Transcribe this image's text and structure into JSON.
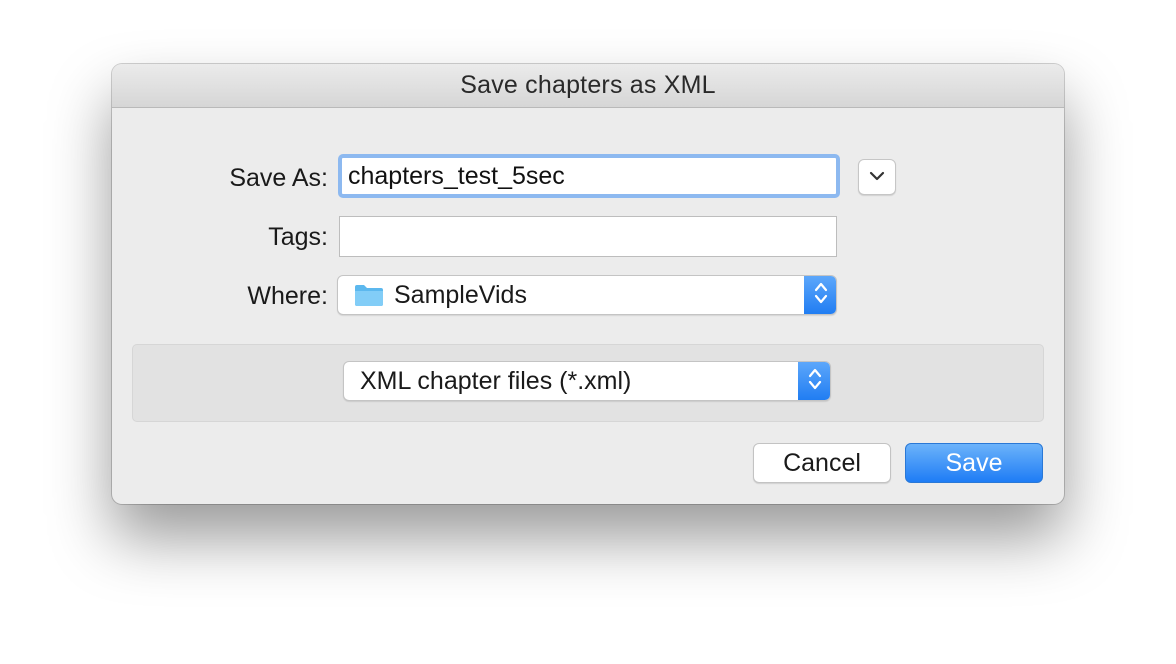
{
  "dialog": {
    "title": "Save chapters as XML"
  },
  "form": {
    "save_as_label": "Save As:",
    "save_as_value": "chapters_test_5sec",
    "tags_label": "Tags:",
    "tags_value": "",
    "where_label": "Where:",
    "where_value": "SampleVids",
    "where_icon": "folder-icon",
    "expand_icon": "chevron-down-icon"
  },
  "format": {
    "selected": "XML chapter files (*.xml)"
  },
  "buttons": {
    "cancel": "Cancel",
    "save": "Save"
  },
  "colors": {
    "accent": "#1e7cf5",
    "focus_ring": "#8db9f0",
    "folder": "#6cc4f5"
  }
}
